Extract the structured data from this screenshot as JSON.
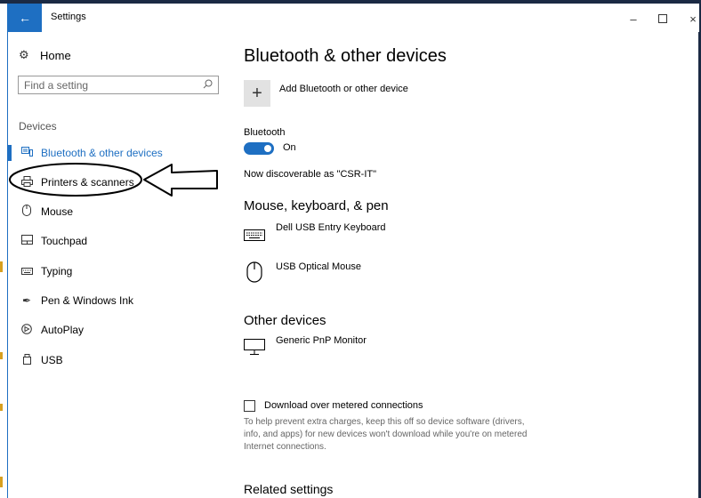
{
  "window": {
    "title": "Settings",
    "back_icon": "back-arrow-icon",
    "controls": {
      "minimize": "–",
      "close": "×"
    }
  },
  "nav": {
    "home_label": "Home",
    "search_placeholder": "Find a setting",
    "section_label": "Devices",
    "items": [
      {
        "label": "Bluetooth & other devices",
        "icon": "bluetooth-devices-icon",
        "active": true
      },
      {
        "label": "Printers & scanners",
        "icon": "printer-icon",
        "active": false
      },
      {
        "label": "Mouse",
        "icon": "mouse-icon",
        "active": false
      },
      {
        "label": "Touchpad",
        "icon": "touchpad-icon",
        "active": false
      },
      {
        "label": "Typing",
        "icon": "keyboard-icon",
        "active": false
      },
      {
        "label": "Pen & Windows Ink",
        "icon": "pen-icon",
        "active": false
      },
      {
        "label": "AutoPlay",
        "icon": "autoplay-icon",
        "active": false
      },
      {
        "label": "USB",
        "icon": "usb-icon",
        "active": false
      }
    ]
  },
  "main": {
    "title": "Bluetooth & other devices",
    "add_device_label": "Add Bluetooth or other device",
    "bluetooth_label": "Bluetooth",
    "bluetooth_state": "On",
    "discoverable_text": "Now discoverable as \"CSR-IT\"",
    "mouse_section_title": "Mouse, keyboard, & pen",
    "mouse_devices": [
      {
        "name": "Dell USB Entry Keyboard",
        "icon": "keyboard-icon"
      },
      {
        "name": "USB Optical Mouse",
        "icon": "mouse-icon"
      }
    ],
    "other_section_title": "Other devices",
    "other_devices": [
      {
        "name": "Generic PnP Monitor",
        "icon": "monitor-icon"
      }
    ],
    "metered_label": "Download over metered connections",
    "metered_checked": false,
    "metered_help": "To help prevent extra charges, keep this off so device software (drivers, info, and apps) for new devices won't download while you're on metered Internet connections.",
    "related_title": "Related settings"
  },
  "colors": {
    "accent": "#1e6fc2"
  }
}
